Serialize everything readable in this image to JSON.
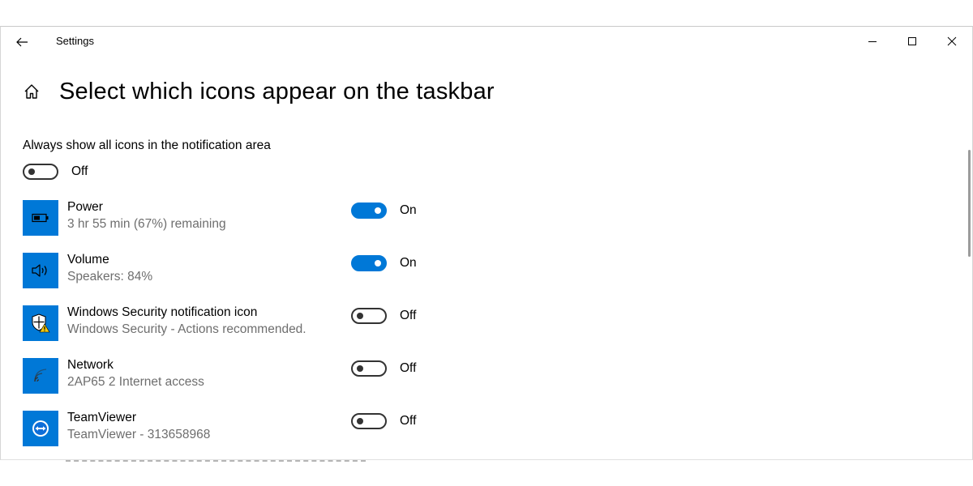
{
  "titlebar": {
    "app_title": "Settings"
  },
  "page": {
    "title": "Select which icons appear on the taskbar"
  },
  "master": {
    "label": "Always show all icons in the notification area",
    "state": "Off"
  },
  "items": [
    {
      "name": "Power",
      "desc": "3 hr 55 min (67%) remaining",
      "state": "On",
      "icon": "battery-icon"
    },
    {
      "name": "Volume",
      "desc": "Speakers: 84%",
      "state": "On",
      "icon": "speaker-icon"
    },
    {
      "name": "Windows Security notification icon",
      "desc": "Windows Security - Actions recommended.",
      "state": "Off",
      "icon": "security-shield-icon"
    },
    {
      "name": "Network",
      "desc": "2AP65 2 Internet access",
      "state": "Off",
      "icon": "wifi-icon"
    },
    {
      "name": "TeamViewer",
      "desc": "TeamViewer - 313658968",
      "state": "Off",
      "icon": "teamviewer-icon"
    }
  ],
  "colors": {
    "accent": "#0078d7",
    "secondary_text": "#6e6e6e"
  }
}
